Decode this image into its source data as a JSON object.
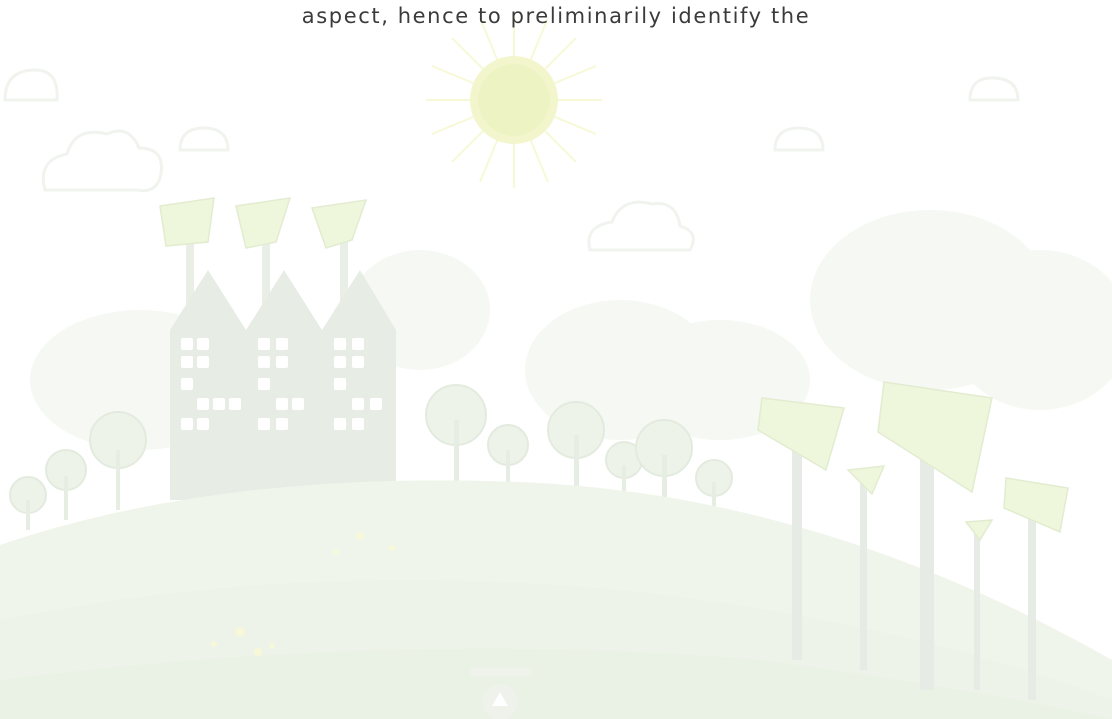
{
  "slide": {
    "text_line": "aspect, hence to preliminarily identify the"
  },
  "colors": {
    "text": "#3b3b3b",
    "sun": "#f4f7c4",
    "cloud": "#f4f7f0",
    "hill": "#eef4e8",
    "silhouette": "#e8eee6",
    "panel": "#eef6dc"
  },
  "illustration": {
    "icons": [
      "sun-icon",
      "factory-icon",
      "solar-panel-icon",
      "tree-icon",
      "cloud-icon",
      "recycle-icon",
      "flower-icon"
    ]
  }
}
